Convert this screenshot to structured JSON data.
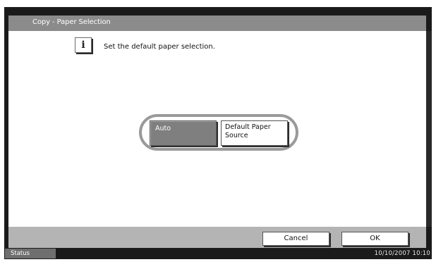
{
  "window": {
    "title": "Copy - Paper Selection"
  },
  "message": {
    "text": "Set the default paper selection.",
    "icon": "info-icon"
  },
  "options": {
    "auto_label": "Auto",
    "default_source_line1": "Default Paper",
    "default_source_line2": "Source",
    "selected": "Auto"
  },
  "footer": {
    "cancel_label": "Cancel",
    "ok_label": "OK"
  },
  "statusbar": {
    "status_label": "Status",
    "datetime": "10/10/2007 10:10"
  },
  "colors": {
    "titlebar": "#8b8b8b",
    "selected_button": "#7f7f7f",
    "bottombar": "#b4b4b4",
    "frame": "#1a1a1a"
  }
}
